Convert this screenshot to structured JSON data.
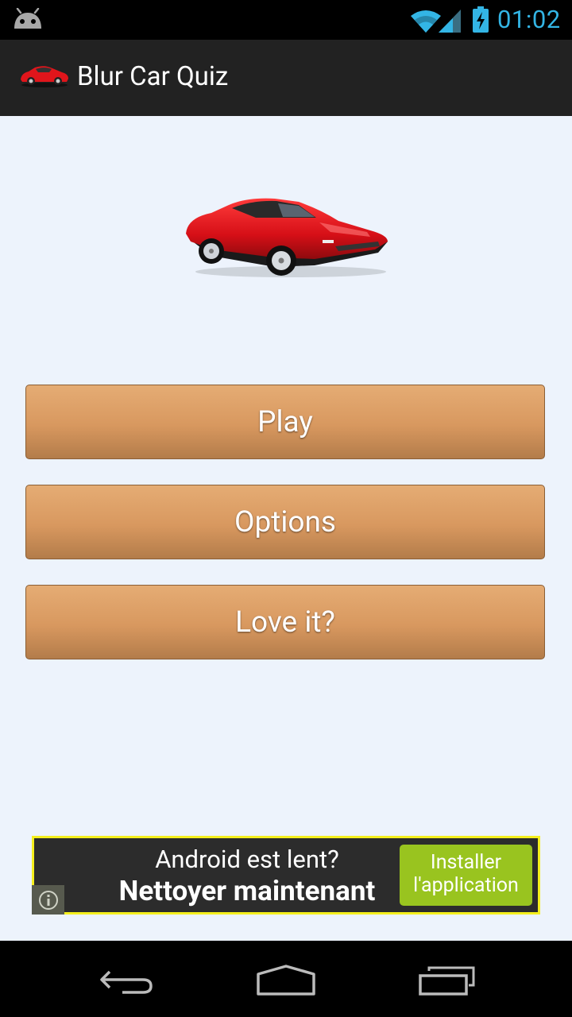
{
  "status_bar": {
    "time": "01:02"
  },
  "action_bar": {
    "title": "Blur Car Quiz"
  },
  "menu": {
    "play_label": "Play",
    "options_label": "Options",
    "love_label": "Love it?"
  },
  "ad": {
    "line1": "Android est lent?",
    "line2": "Nettoyer maintenant",
    "cta_line1": "Installer",
    "cta_line2": "l'application"
  },
  "icons": [
    "android-icon",
    "wifi-icon",
    "signal-icon",
    "battery-icon",
    "car-icon",
    "info-icon",
    "back-icon",
    "home-icon",
    "recents-icon"
  ],
  "colors": {
    "accent": "#33b5e5",
    "button": "#d8985f",
    "ad_border": "#f5ef1d",
    "ad_cta": "#99c41f"
  }
}
